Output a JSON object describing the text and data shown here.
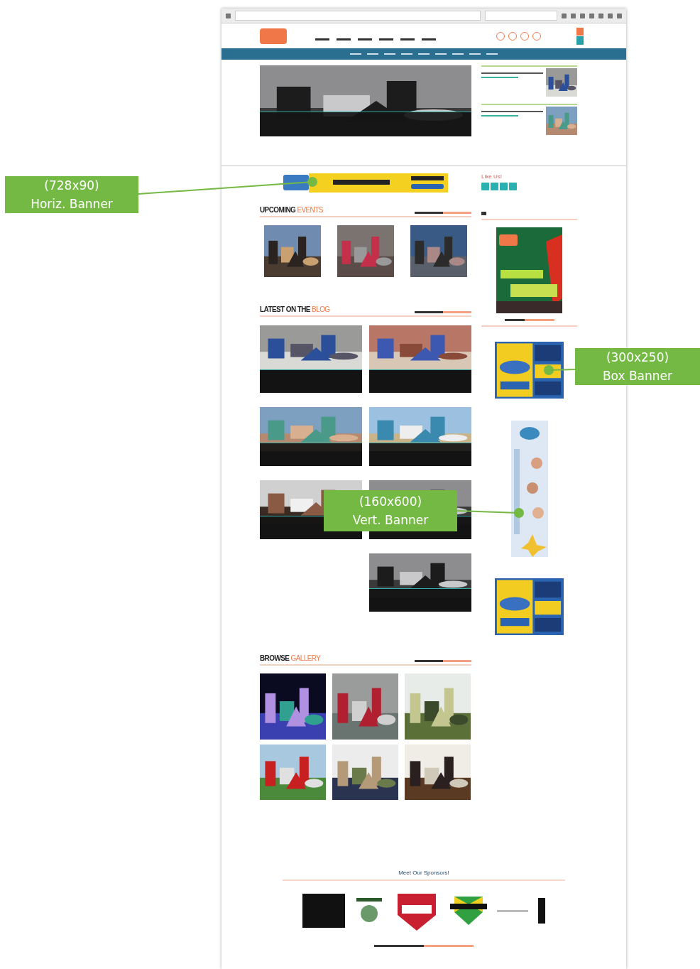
{
  "callouts": [
    {
      "size": "(728x90)",
      "label": "Horiz. Banner"
    },
    {
      "size": "(300x250)",
      "label": "Box Banner"
    },
    {
      "size": "(160x600)",
      "label": "Vert. Banner"
    }
  ],
  "sections": [
    {
      "title": "UPCOMING",
      "accent": "EVENTS"
    },
    {
      "title": "LATEST ON THE",
      "accent": "BLOG"
    },
    {
      "title": "BROWSE",
      "accent": "GALLERY"
    }
  ],
  "sidebar": {
    "like_heading": "Like Us!"
  },
  "sponsors": {
    "heading": "Meet Our Sponsors!"
  }
}
